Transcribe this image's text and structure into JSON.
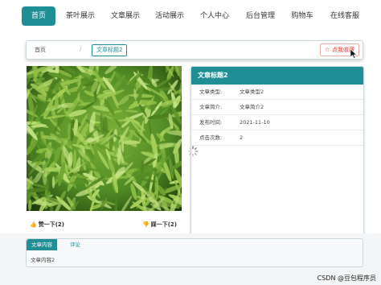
{
  "nav": {
    "items": [
      "首页",
      "茶叶展示",
      "文章展示",
      "活动展示",
      "个人中心",
      "后台管理",
      "购物车",
      "在线客服"
    ],
    "active_index": 0,
    "accent": "#1f8f95"
  },
  "breadcrumb": {
    "home": "首页",
    "separator": "/",
    "current": "文章标题2"
  },
  "favorite": {
    "icon": "star-icon",
    "label": "点我收藏"
  },
  "article": {
    "image": "green-tea-leaves",
    "like_label": "赞一下(2)",
    "dislike_label": "踩一下(2)"
  },
  "info": {
    "title": "文章标题2",
    "rows": [
      {
        "key": "文章类型:",
        "value": "文章类型2"
      },
      {
        "key": "文章简介:",
        "value": "文章简介2"
      },
      {
        "key": "发布时间:",
        "value": "2021-11-10"
      },
      {
        "key": "点击次数:",
        "value": "2"
      }
    ]
  },
  "tabs": {
    "items": [
      "文章内容",
      "评论"
    ],
    "active_index": 0,
    "content": "文章内容2"
  },
  "watermark": "CSDN @豆包程序员"
}
